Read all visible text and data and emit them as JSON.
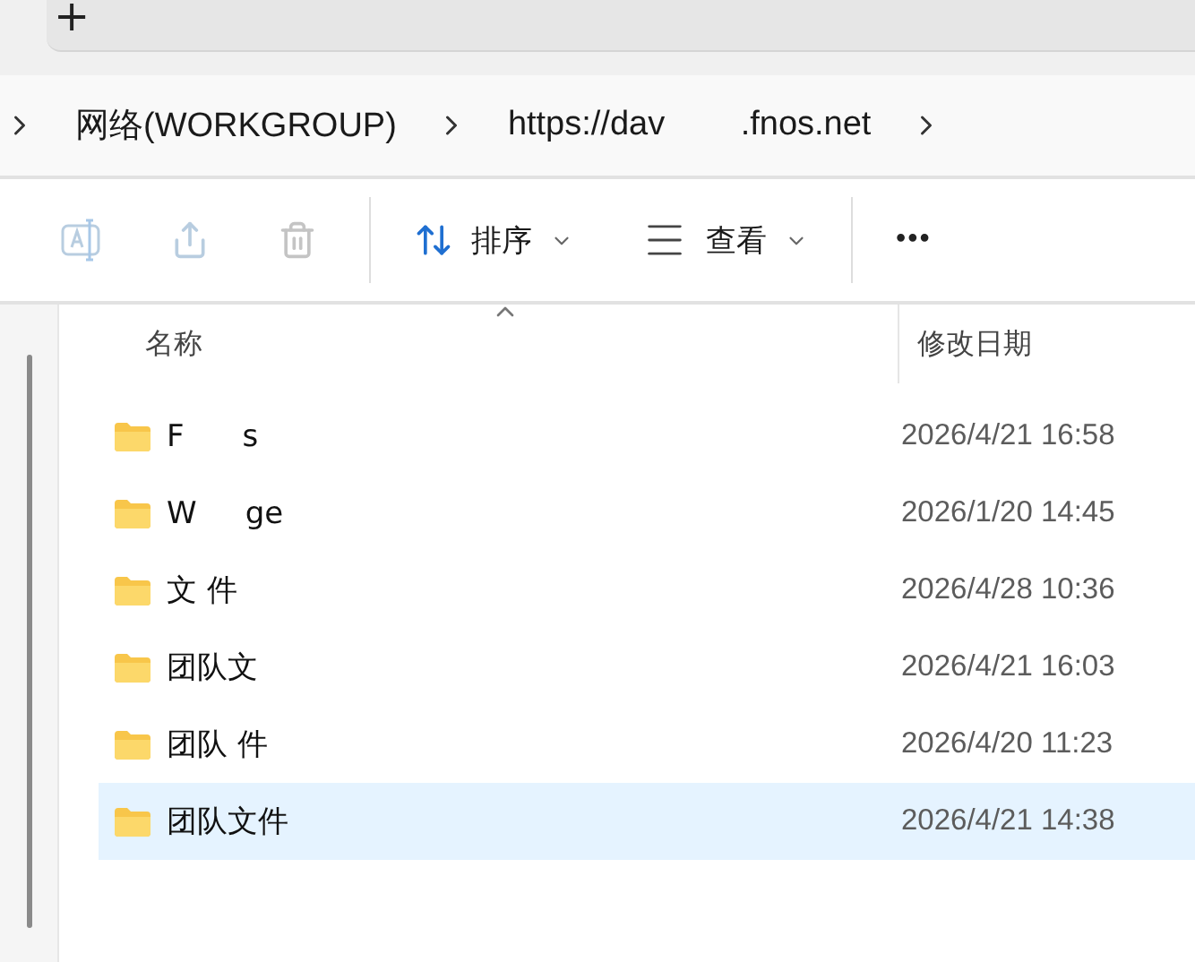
{
  "tab_strip": {
    "new_tab": "+"
  },
  "breadcrumb": [
    {
      "label": "网络(WORKGROUP)"
    },
    {
      "label": "https://dav        .fnos.net"
    }
  ],
  "toolbar": {
    "sort": "排序",
    "view": "查看",
    "more": "•••"
  },
  "columns": [
    {
      "label": "名称"
    },
    {
      "label": "修改日期"
    }
  ],
  "rows": [
    {
      "name": "F      s",
      "date": "2026/4/21 16:58",
      "selected": false
    },
    {
      "name": "W     ge",
      "date": "2026/1/20 14:45",
      "selected": false
    },
    {
      "name": "文 件",
      "date": "2026/4/28 10:36",
      "selected": false
    },
    {
      "name": "团队文",
      "date": "2026/4/21 16:03",
      "selected": false
    },
    {
      "name": "团队 件",
      "date": "2026/4/20 11:23",
      "selected": false
    },
    {
      "name": "团队文件",
      "date": "2026/4/21 14:38",
      "selected": true
    }
  ]
}
